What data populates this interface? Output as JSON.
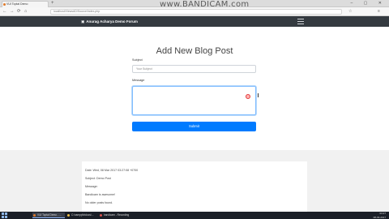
{
  "browser": {
    "tab_title": "VUI Toptal Demo",
    "new_tab": "+",
    "url": "localhost/ViewsAD/Source/index.php",
    "window_controls": "– ▢ ✕",
    "back": "←",
    "forward": "→",
    "reload": "⟳",
    "home": "⌂",
    "star": "☆",
    "menu": "≡"
  },
  "watermark": "www.BANDICAM.com",
  "site": {
    "brand": "Anurag Acharya Demo Forum",
    "brand_icon": "book-icon"
  },
  "form": {
    "title": "Add New Blog Post",
    "subject_label": "Subject",
    "subject_placeholder": "Your Subject",
    "message_label": "Message",
    "submit_label": "Submit"
  },
  "post": {
    "date": "Date: Wed, 08 Mar 2017 03:27:08 +0700",
    "subject": "Subject: Demo Post",
    "message_label": "Message:",
    "message_body": "Bandicam is awesome!",
    "no_posts": "No older posts found."
  },
  "taskbar": {
    "items": [
      {
        "label": "VUI Toptal Demo - ..."
      },
      {
        "label": "C:\\xampp\\htdocs\\..."
      },
      {
        "label": "bandicam - Recording"
      }
    ],
    "time": "03:27",
    "date": "08-03-2017"
  },
  "colors": {
    "navbar": "#343a40",
    "primary": "#007bff",
    "record": "#e23b3b"
  }
}
